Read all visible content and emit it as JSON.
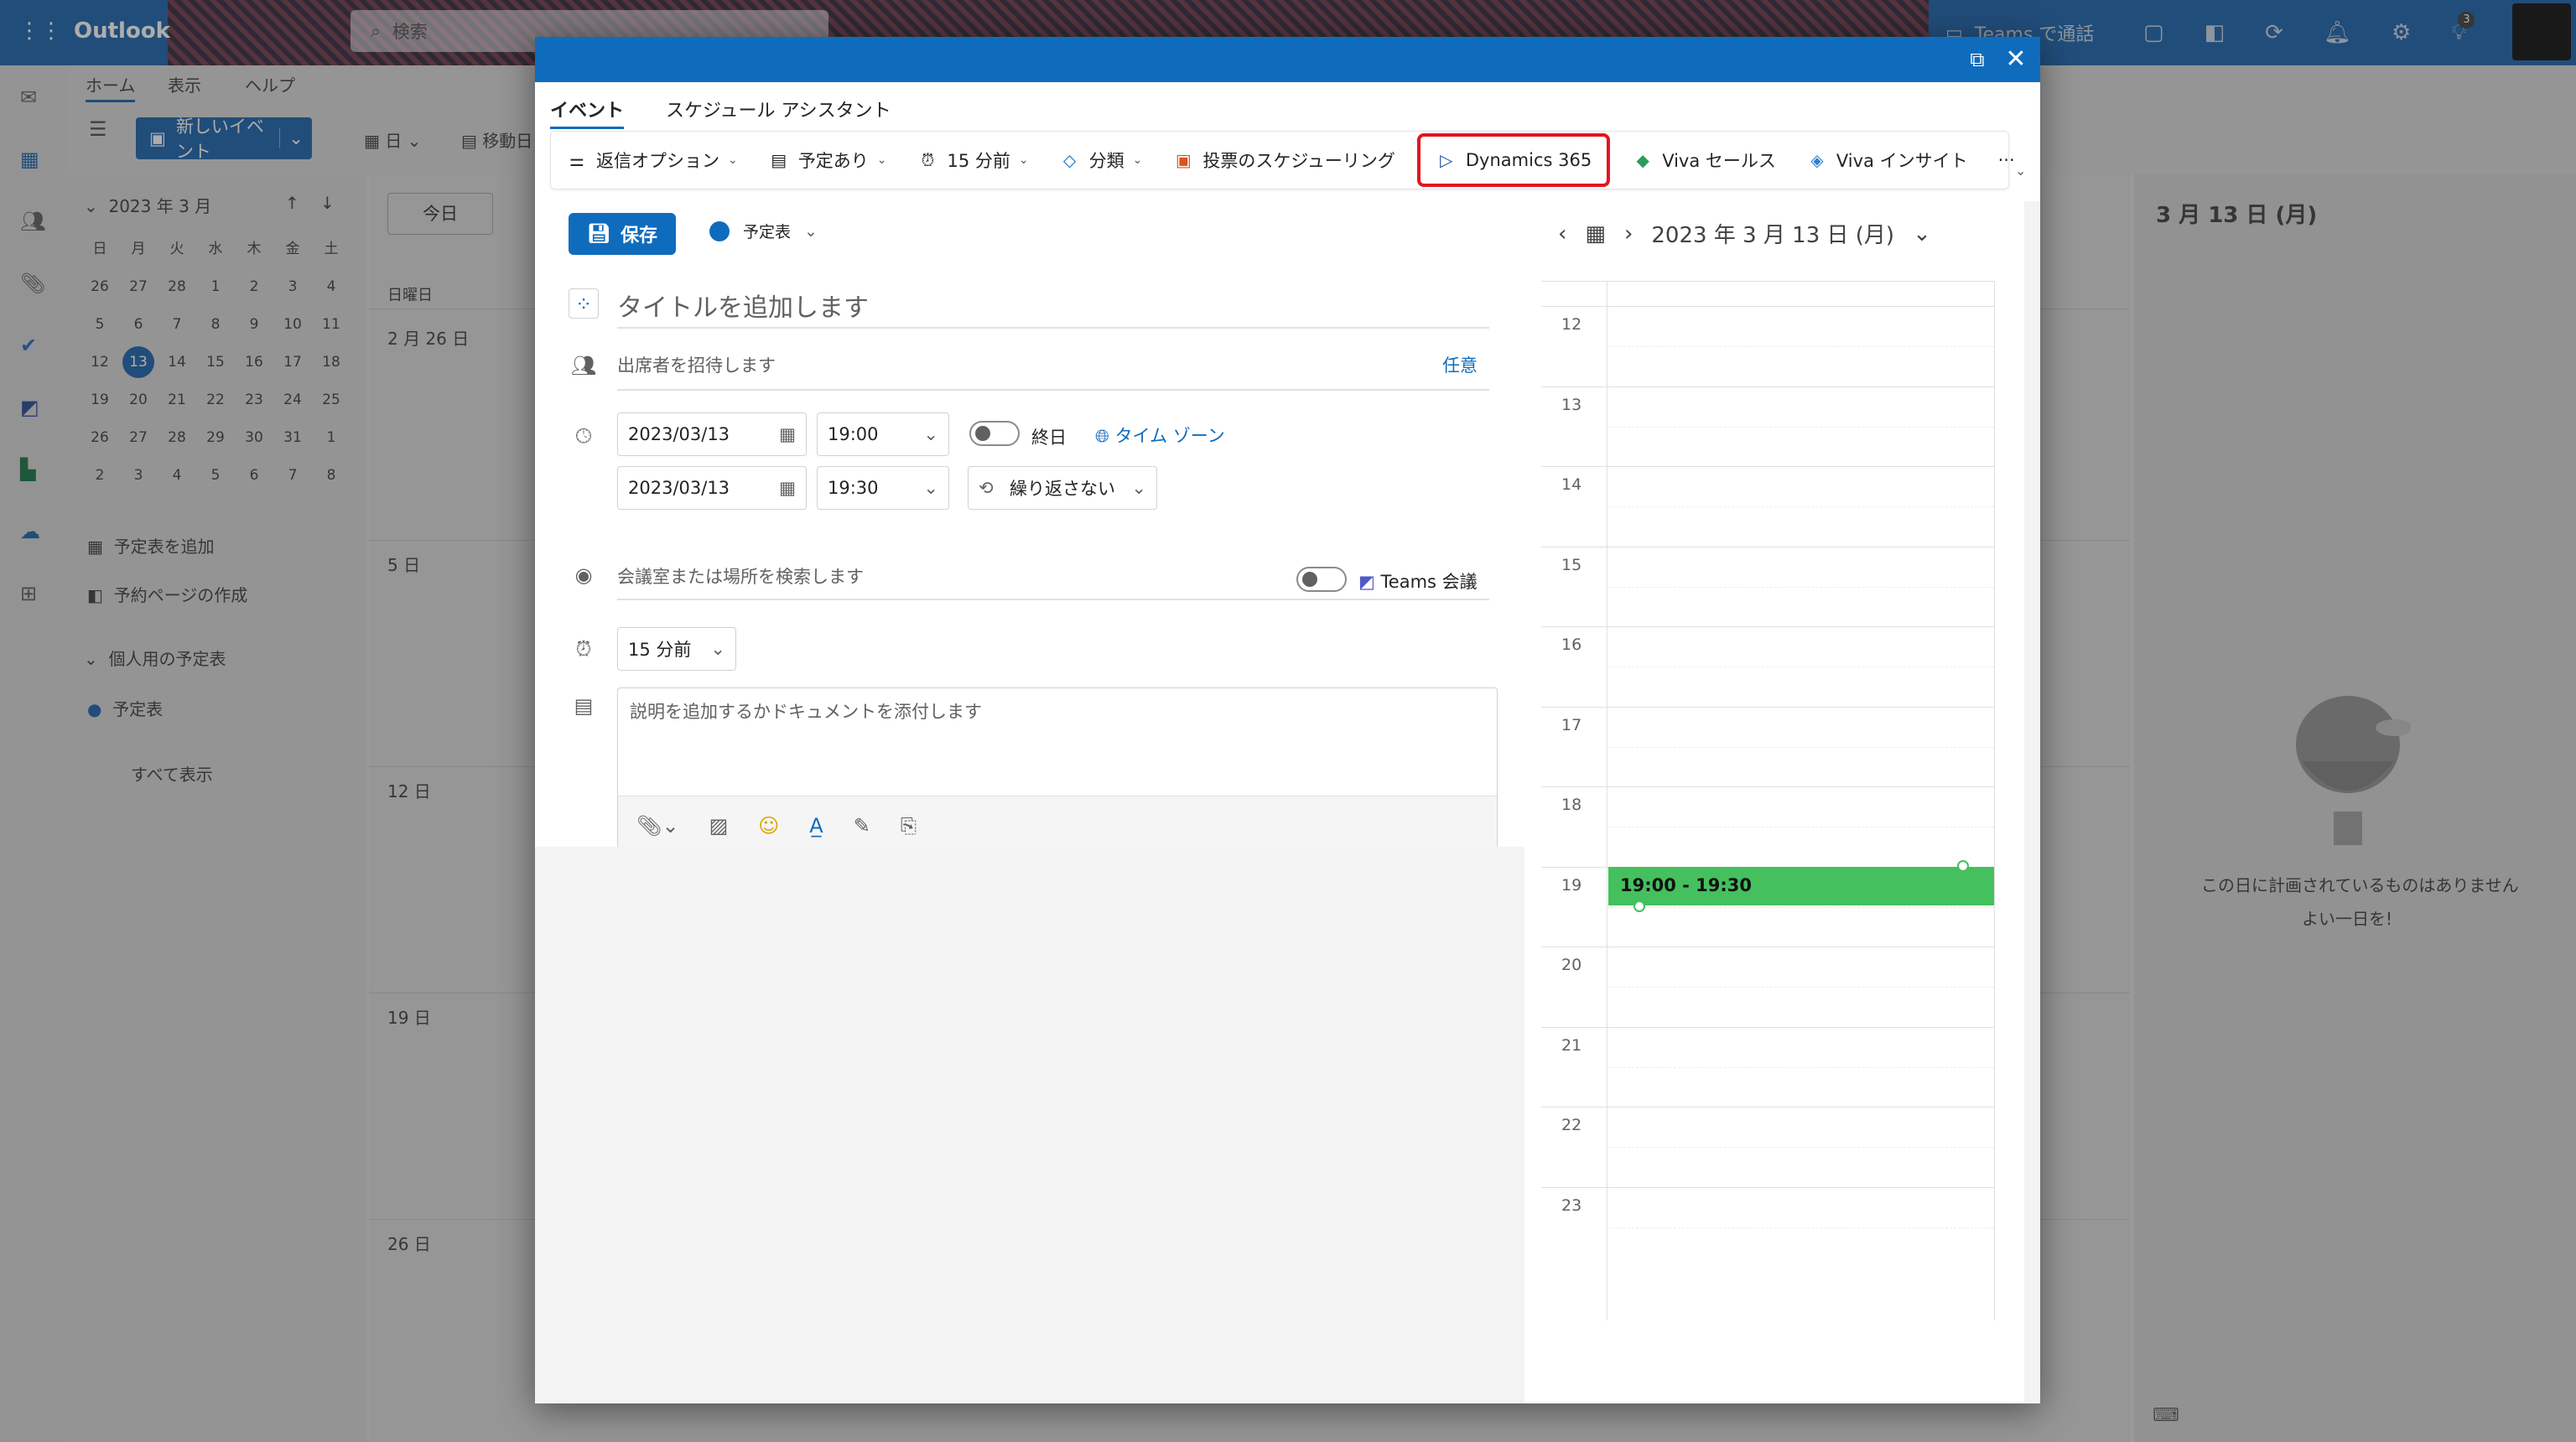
{
  "app": {
    "name": "Outlook",
    "search_placeholder": "検索",
    "teams_call": "Teams で通話",
    "notification_count": "3"
  },
  "ribbon": {
    "tabs": [
      "ホーム",
      "表示",
      "ヘルプ"
    ],
    "new_event": "新しいイベント",
    "day_view": "日",
    "move": "移動日"
  },
  "mini_calendar": {
    "month_label": "2023 年 3 月",
    "weekdays": [
      "日",
      "月",
      "火",
      "水",
      "木",
      "金",
      "土"
    ],
    "weeks": [
      [
        "26",
        "27",
        "28",
        "1",
        "2",
        "3",
        "4"
      ],
      [
        "5",
        "6",
        "7",
        "8",
        "9",
        "10",
        "11"
      ],
      [
        "12",
        "13",
        "14",
        "15",
        "16",
        "17",
        "18"
      ],
      [
        "19",
        "20",
        "21",
        "22",
        "23",
        "24",
        "25"
      ],
      [
        "26",
        "27",
        "28",
        "29",
        "30",
        "31",
        "1"
      ],
      [
        "2",
        "3",
        "4",
        "5",
        "6",
        "7",
        "8"
      ]
    ],
    "selected": "13"
  },
  "left_nav": {
    "add_calendar": "予定表を追加",
    "booking_page": "予約ページの作成",
    "personal_calendars": "個人用の予定表",
    "calendar": "予定表",
    "show_all": "すべて表示"
  },
  "calendar_grid": {
    "today_button": "今日",
    "sunday_label": "日曜日",
    "week_labels": [
      "2 月 26 日",
      "5 日",
      "12 日",
      "19 日",
      "26 日"
    ]
  },
  "right_pane": {
    "date": "3 月 13 日 (月)",
    "empty_title": "この日に計画されているものはありません",
    "empty_sub": "よい一日を!"
  },
  "dialog": {
    "tabs": [
      "イベント",
      "スケジュール アシスタント"
    ],
    "toolbar": {
      "reply_options": "返信オプション",
      "busy": "予定あり",
      "reminder": "15 分前",
      "categorize": "分類",
      "poll": "投票のスケジューリング",
      "dynamics": "Dynamics 365",
      "viva_sales": "Viva セールス",
      "viva_insights": "Viva インサイト",
      "more": "···"
    },
    "save": "保存",
    "calendar_name": "予定表",
    "title_placeholder": "タイトルを追加します",
    "attendees_placeholder": "出席者を招待します",
    "optional": "任意",
    "start_date": "2023/03/13",
    "start_time": "19:00",
    "end_date": "2023/03/13",
    "end_time": "19:30",
    "all_day": "終日",
    "time_zone": "タイム ゾーン",
    "repeat": "繰り返さない",
    "location_placeholder": "会議室または場所を検索します",
    "teams_meeting": "Teams 会議",
    "reminder": "15 分前",
    "description_placeholder": "説明を追加するかドキュメントを添付します"
  },
  "day_view": {
    "date_label": "2023 年 3 月 13 日 (月)",
    "hours": [
      "12",
      "13",
      "14",
      "15",
      "16",
      "17",
      "18",
      "19",
      "20",
      "21",
      "22",
      "23"
    ],
    "event_time": "19:00 - 19:30",
    "event_color": "#44c05e"
  },
  "colors": {
    "accent": "#0f6cbd",
    "highlight": "#e3141e"
  }
}
